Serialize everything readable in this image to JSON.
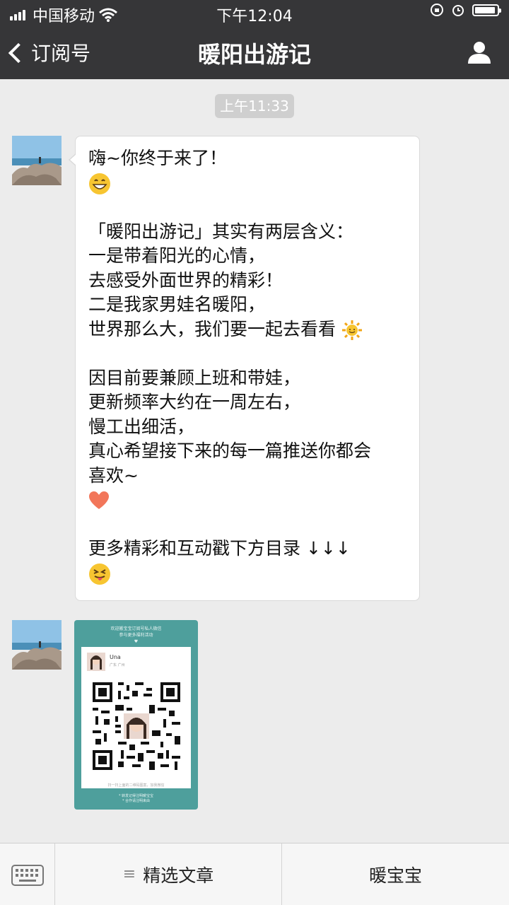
{
  "status_bar": {
    "carrier": "中国移动",
    "time": "下午12:04"
  },
  "nav": {
    "back_label": "订阅号",
    "title": "暖阳出游记",
    "icons": [
      "chevron-left-icon",
      "user-icon"
    ]
  },
  "chat": {
    "timestamp": "上午11:33",
    "message_lines": [
      "嗨~你终于来了！",
      "",
      "",
      "「暖阳出游记」其实有两层含义：",
      "一是带着阳光的心情，",
      "去感受外面世界的精彩！",
      "二是我家男娃名暖阳，",
      "世界那么大，我们要一起去看看",
      "",
      "因目前要兼顾上班和带娃，",
      "更新频率大约在一周左右，",
      "慢工出细活，",
      "真心希望接下来的每一篇推送你都会",
      "喜欢~",
      "",
      "",
      "更多精彩和互动戳下方目录 ↓↓↓",
      ""
    ],
    "emojis": [
      "grin-emoji",
      "sun-emoji",
      "heart-emoji",
      "tongue-emoji"
    ],
    "qr_card": {
      "top_line1": "欢迎搬宝宝订阅号私人微信",
      "top_line2": "参与更多福利活动",
      "name": "Una",
      "location": "广东 广州",
      "foot": "扫一扫上面的二维码图案，加我微信",
      "bottom_line1": "* 转发记得注明暖宝宝",
      "bottom_line2": "* 合作请注明来由"
    }
  },
  "bottom_menu": {
    "keyboard_icon": "keyboard-icon",
    "item1": "精选文章",
    "item2": "暖宝宝",
    "item1_prefix": "≡"
  },
  "colors": {
    "bar_bg": "#363638",
    "chat_bg": "#ececec",
    "qr_card": "#4e9f9c"
  }
}
